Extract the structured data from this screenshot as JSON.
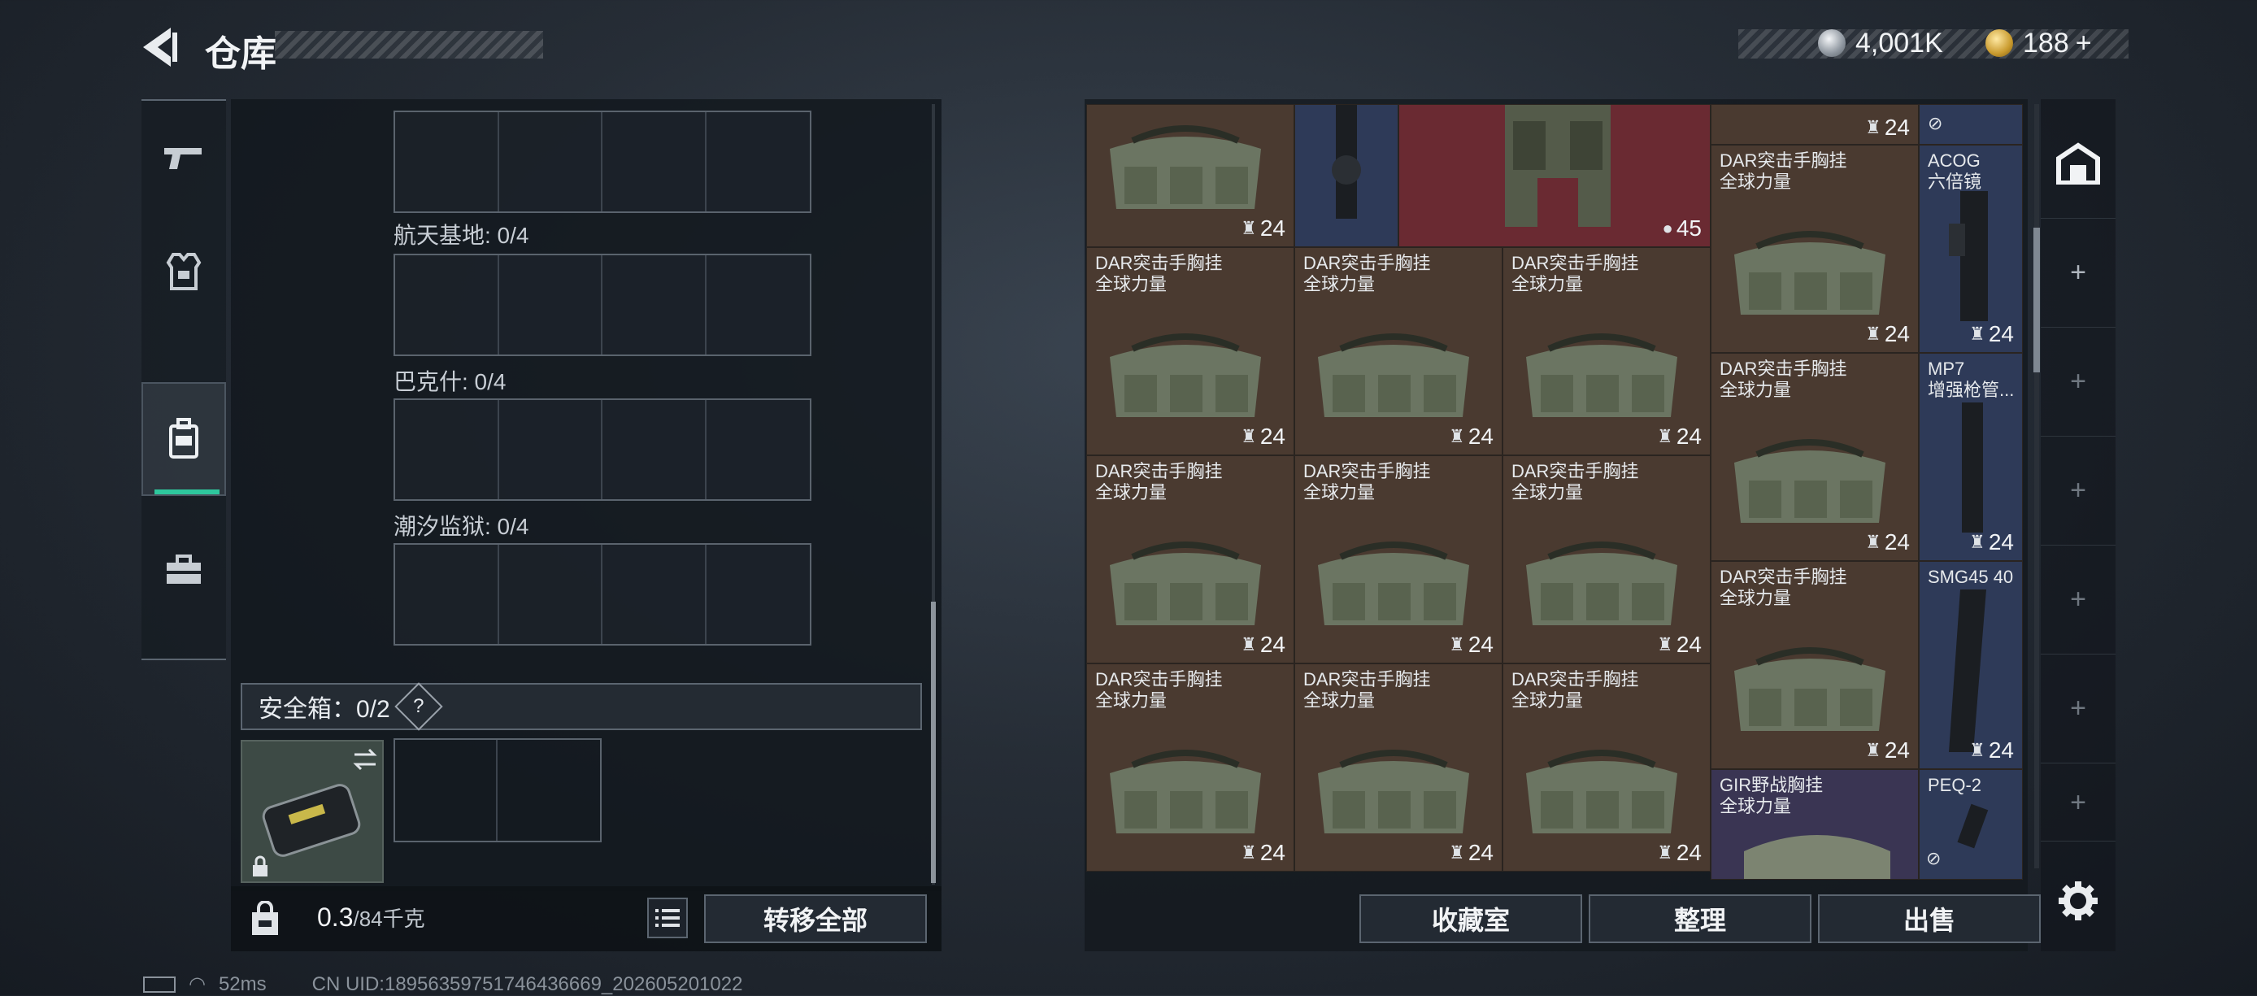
{
  "header": {
    "title": "仓库",
    "currency_silver": "4,001K",
    "currency_gold": "188",
    "add_symbol": "+"
  },
  "left_panel": {
    "maps": [
      {
        "label": "航天基地: 0/4"
      },
      {
        "label": "巴克什: 0/4"
      },
      {
        "label": "潮汐监狱: 0/4"
      }
    ],
    "safe_box_label": "安全箱：0/2",
    "help": "?",
    "weight_current": "0.3",
    "weight_max": "/84千克",
    "transfer_all": "转移全部"
  },
  "inventory": {
    "top_row_qty": [
      "24",
      "45",
      "24"
    ],
    "cells": [
      {
        "name": "DAR突击手胸挂\n全球力量",
        "qty": "24"
      },
      {
        "name": "DAR突击手胸挂\n全球力量",
        "qty": "24"
      },
      {
        "name": "DAR突击手胸挂\n全球力量",
        "qty": "24"
      },
      {
        "name": "DAR突击手胸挂\n全球力量",
        "qty": "24"
      },
      {
        "name": "DAR突击手胸挂\n全球力量",
        "qty": "24"
      },
      {
        "name": "DAR突击手胸挂\n全球力量",
        "qty": "24"
      },
      {
        "name": "DAR突击手胸挂\n全球力量",
        "qty": "24"
      },
      {
        "name": "DAR突击手胸挂\n全球力量",
        "qty": "24"
      },
      {
        "name": "DAR突击手胸挂\n全球力量",
        "qty": "24"
      }
    ],
    "col4": [
      {
        "name": "DAR突击手胸挂\n全球力量",
        "qty": "24"
      },
      {
        "name": "DAR突击手胸挂\n全球力量",
        "qty": "24"
      },
      {
        "name": "DAR突击手胸挂\n全球力量",
        "qty": "24"
      },
      {
        "name": "GIR野战胸挂\n全球力量",
        "qty": ""
      }
    ],
    "col5": [
      {
        "name": "ACOG\n六倍镜",
        "qty": "24"
      },
      {
        "name": "MP7\n增强枪管...",
        "qty": "24"
      },
      {
        "name": "SMG45 40",
        "qty": "24"
      },
      {
        "name": "PEQ-2",
        "qty": ""
      }
    ]
  },
  "actions": {
    "collection": "收藏室",
    "sort": "整理",
    "sell": "出售"
  },
  "status": {
    "ping": "52ms",
    "uid": "CN UID:18956359751746436669_202605201022"
  },
  "colors": {
    "accent_green": "#2ec79d",
    "bag_cell": "#4a3a30",
    "navy_cell": "#2e3a58"
  }
}
